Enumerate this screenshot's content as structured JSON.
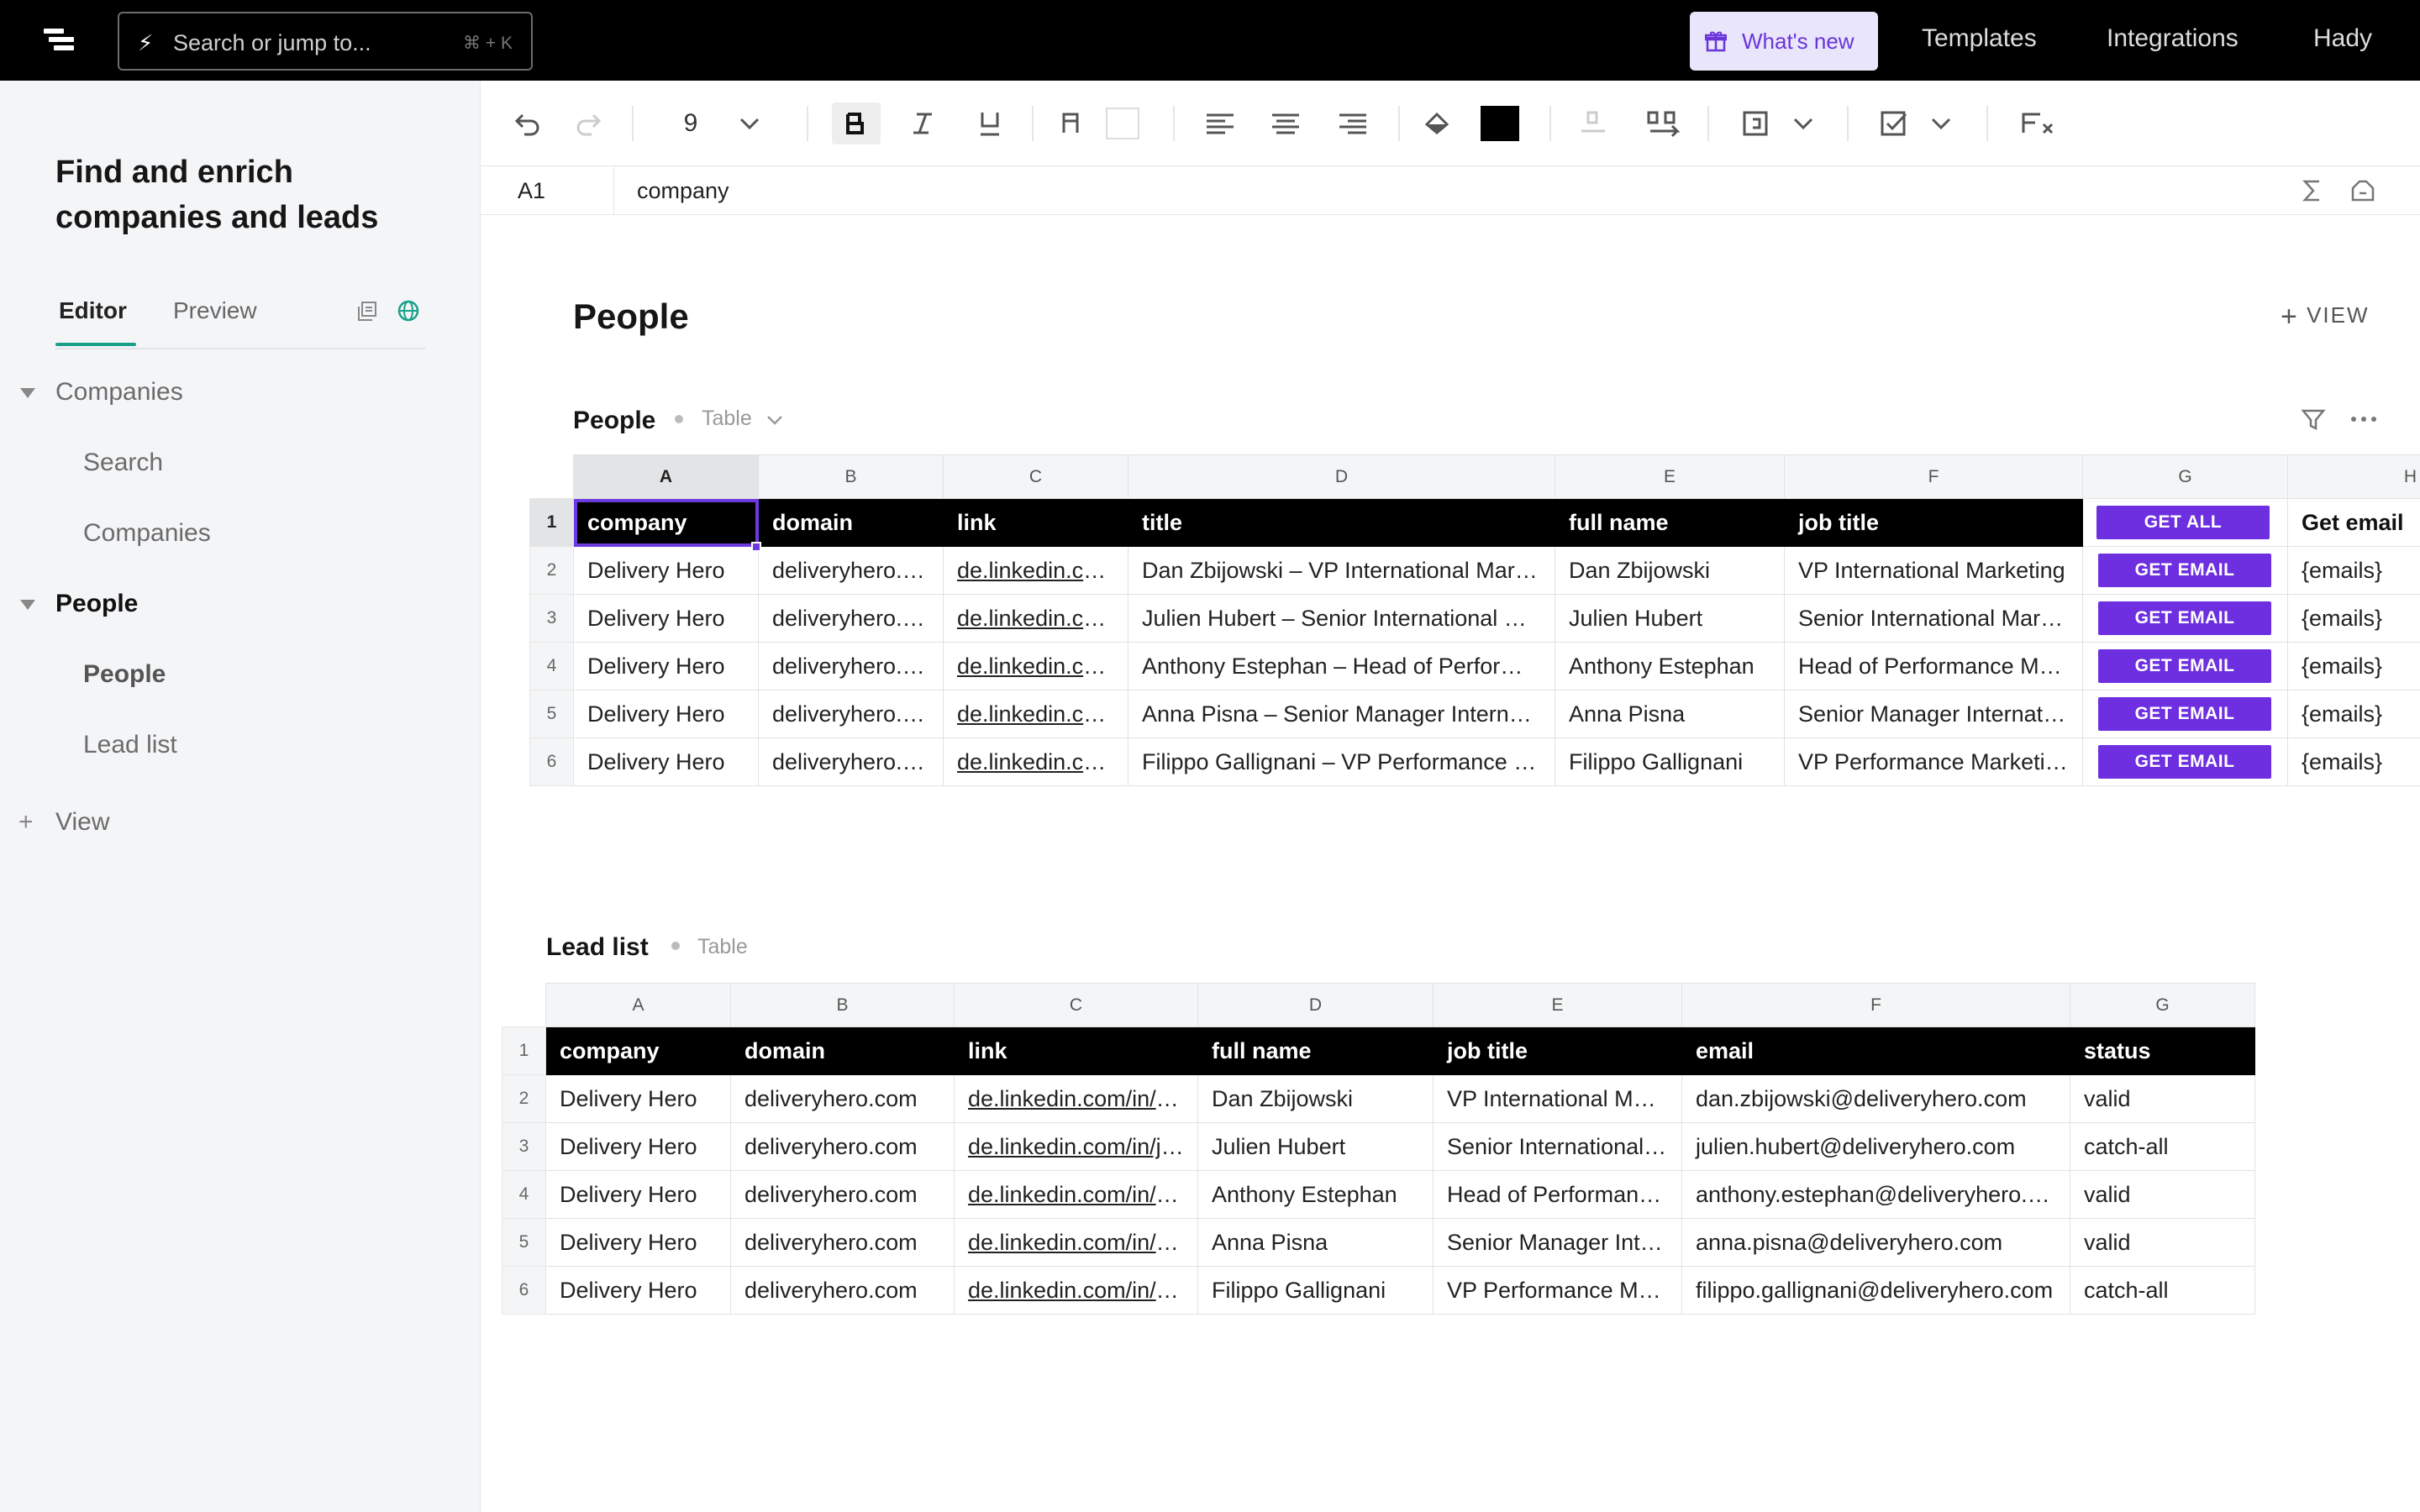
{
  "topbar": {
    "search_placeholder": "Search or jump to...",
    "search_shortcut": "⌘ + K",
    "whats_new": "What's new",
    "nav": [
      "Templates",
      "Integrations",
      "Hady"
    ]
  },
  "sidebar": {
    "title": "Find and enrich companies and leads",
    "tabs": [
      "Editor",
      "Preview"
    ],
    "groups": [
      {
        "label": "Companies",
        "items": [
          "Search",
          "Companies"
        ]
      },
      {
        "label": "People",
        "items": [
          "People",
          "Lead list"
        ]
      }
    ],
    "add_view": "View"
  },
  "toolbar": {
    "font_size": "9"
  },
  "formula": {
    "cell": "A1",
    "value": "company"
  },
  "page": {
    "title": "People",
    "add_view": "VIEW"
  },
  "people": {
    "title": "People",
    "type": "Table",
    "columns": [
      "A",
      "B",
      "C",
      "D",
      "E",
      "F",
      "G",
      "H"
    ],
    "headers": [
      "company",
      "domain",
      "link",
      "title",
      "full name",
      "job title",
      "GET ALL",
      "Get email"
    ],
    "rows": [
      [
        "Delivery Hero",
        "deliveryhero.com",
        "de.linkedin.com/in/dan-zbijowski",
        "Dan Zbijowski – VP International Marketing",
        "Dan Zbijowski",
        "VP International Marketing",
        "GET EMAIL",
        "{emails}"
      ],
      [
        "Delivery Hero",
        "deliveryhero.com",
        "de.linkedin.com/in/julien-hubert",
        "Julien Hubert – Senior International Marketing",
        "Julien Hubert",
        "Senior International Marketing",
        "GET EMAIL",
        "{emails}"
      ],
      [
        "Delivery Hero",
        "deliveryhero.com",
        "de.linkedin.com/in/anthony-estephan",
        "Anthony Estephan – Head of Performance Marketing",
        "Anthony Estephan",
        "Head of Performance Marketing",
        "GET EMAIL",
        "{emails}"
      ],
      [
        "Delivery Hero",
        "deliveryhero.com",
        "de.linkedin.com/in/anna-pisna",
        "Anna Pisna – Senior Manager International",
        "Anna Pisna",
        "Senior Manager International",
        "GET EMAIL",
        "{emails}"
      ],
      [
        "Delivery Hero",
        "deliveryhero.com",
        "de.linkedin.com/in/filippo-gallignani",
        "Filippo Gallignani – VP Performance Marketing",
        "Filippo Gallignani",
        "VP Performance Marketing",
        "GET EMAIL",
        "{emails}"
      ]
    ]
  },
  "leads": {
    "title": "Lead list",
    "type": "Table",
    "columns": [
      "A",
      "B",
      "C",
      "D",
      "E",
      "F",
      "G"
    ],
    "headers": [
      "company",
      "domain",
      "link",
      "full name",
      "job title",
      "email",
      "status"
    ],
    "rows": [
      [
        "Delivery Hero",
        "deliveryhero.com",
        "de.linkedin.com/in/dan-zbijowski",
        "Dan Zbijowski",
        "VP International Marketing",
        "dan.zbijowski@deliveryhero.com",
        "valid"
      ],
      [
        "Delivery Hero",
        "deliveryhero.com",
        "de.linkedin.com/in/julien-hubert",
        "Julien Hubert",
        "Senior International Marketing",
        "julien.hubert@deliveryhero.com",
        "catch-all"
      ],
      [
        "Delivery Hero",
        "deliveryhero.com",
        "de.linkedin.com/in/anthony-estephan",
        "Anthony Estephan",
        "Head of Performance Marketing",
        "anthony.estephan@deliveryhero.com",
        "valid"
      ],
      [
        "Delivery Hero",
        "deliveryhero.com",
        "de.linkedin.com/in/anna-pisna",
        "Anna Pisna",
        "Senior Manager International",
        "anna.pisna@deliveryhero.com",
        "valid"
      ],
      [
        "Delivery Hero",
        "deliveryhero.com",
        "de.linkedin.com/in/filippo-gallignani",
        "Filippo Gallignani",
        "VP Performance Marketing",
        "filippo.gallignani@deliveryhero.com",
        "catch-all"
      ]
    ]
  },
  "colors": {
    "accent": "#6d2fe0",
    "teal": "#1aa08a",
    "topbar": "#000000"
  }
}
